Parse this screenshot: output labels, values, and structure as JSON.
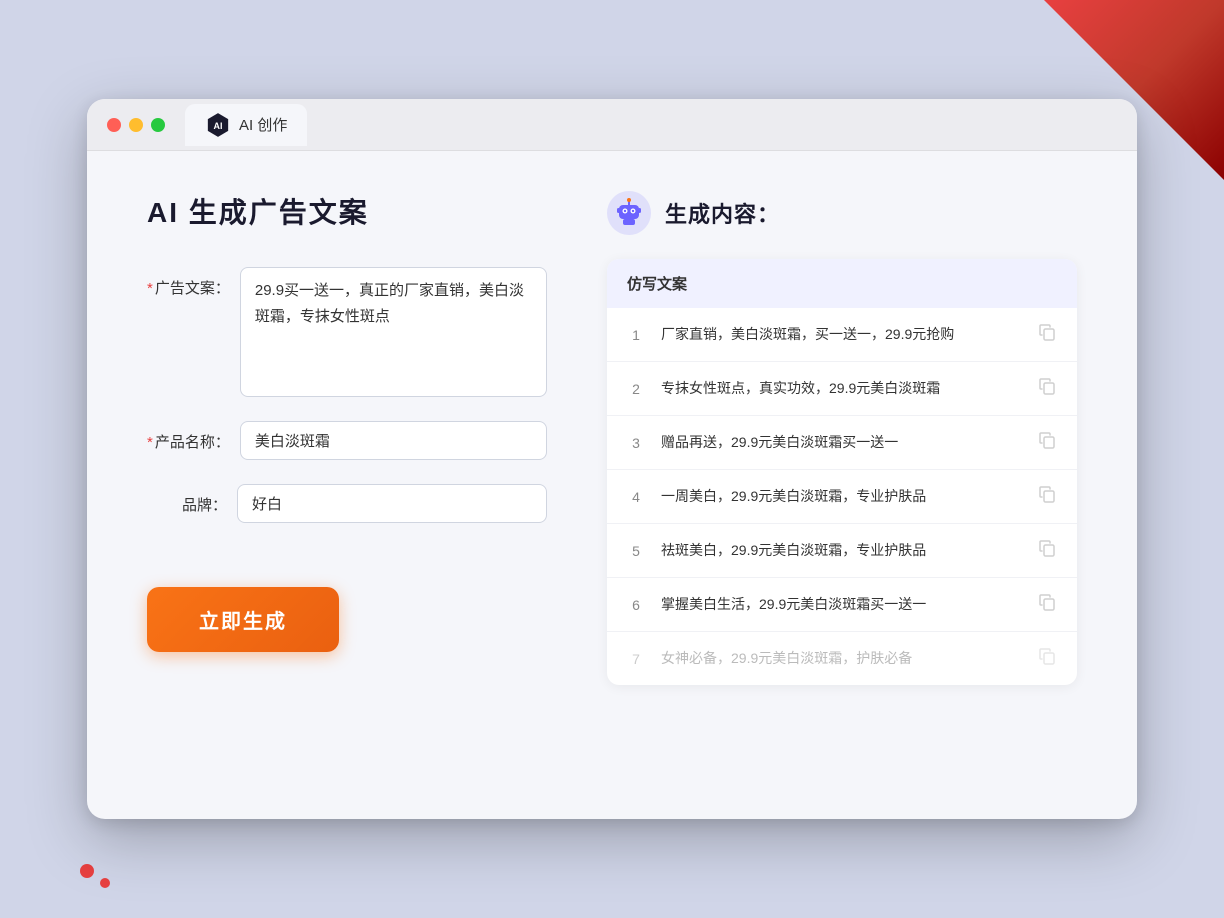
{
  "window": {
    "tab_label": "AI 创作"
  },
  "page": {
    "title": "AI 生成广告文案"
  },
  "form": {
    "ad_copy_label": "广告文案：",
    "ad_copy_required": "*",
    "ad_copy_value": "29.9买一送一，真正的厂家直销，美白淡斑霜，专抹女性斑点",
    "product_name_label": "产品名称：",
    "product_name_required": "*",
    "product_name_value": "美白淡斑霜",
    "brand_label": "品牌：",
    "brand_value": "好白",
    "generate_button": "立即生成"
  },
  "result": {
    "header": "生成内容：",
    "column_label": "仿写文案",
    "items": [
      {
        "id": 1,
        "text": "厂家直销，美白淡斑霜，买一送一，29.9元抢购",
        "dimmed": false
      },
      {
        "id": 2,
        "text": "专抹女性斑点，真实功效，29.9元美白淡斑霜",
        "dimmed": false
      },
      {
        "id": 3,
        "text": "赠品再送，29.9元美白淡斑霜买一送一",
        "dimmed": false
      },
      {
        "id": 4,
        "text": "一周美白，29.9元美白淡斑霜，专业护肤品",
        "dimmed": false
      },
      {
        "id": 5,
        "text": "祛斑美白，29.9元美白淡斑霜，专业护肤品",
        "dimmed": false
      },
      {
        "id": 6,
        "text": "掌握美白生活，29.9元美白淡斑霜买一送一",
        "dimmed": false
      },
      {
        "id": 7,
        "text": "女神必备，29.9元美白淡斑霜，护肤必备",
        "dimmed": true
      }
    ]
  }
}
